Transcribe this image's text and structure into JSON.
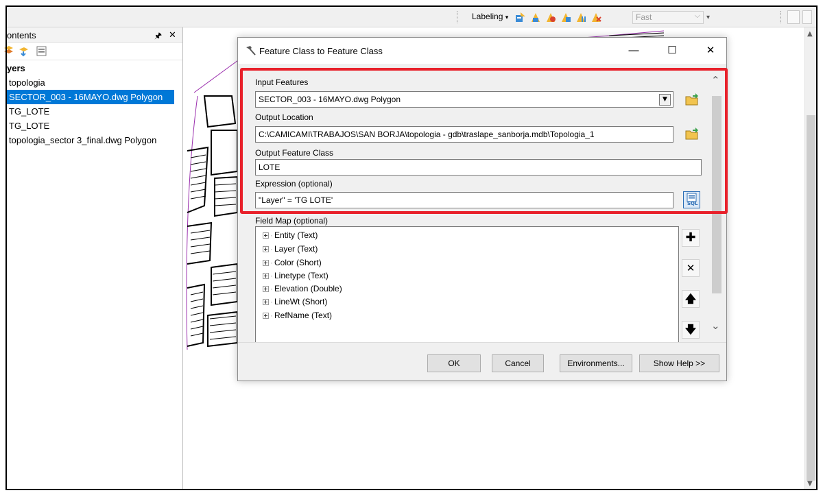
{
  "toolbar": {
    "labeling_label": "Labeling",
    "fast_value": "Fast"
  },
  "toc": {
    "header_label": "ontents",
    "group_label": "yers",
    "layers": [
      {
        "name": "topologia"
      },
      {
        "name": "SECTOR_003 - 16MAYO.dwg Polygon",
        "selected": true
      },
      {
        "name": "TG_LOTE"
      },
      {
        "name": "TG_LOTE"
      },
      {
        "name": "topologia_sector 3_final.dwg Polygon"
      }
    ]
  },
  "dialog": {
    "title": "Feature Class to Feature Class",
    "input_features_label": "Input Features",
    "input_features_value": "SECTOR_003 - 16MAYO.dwg Polygon",
    "output_location_label": "Output Location",
    "output_location_value": "C:\\CAMICAMI\\TRABAJOS\\SAN BORJA\\topologia - gdb\\traslape_sanborja.mdb\\Topologia_1",
    "output_feature_class_label": "Output Feature Class",
    "output_feature_class_value": "LOTE",
    "expression_label": "Expression (optional)",
    "expression_value": "\"Layer\" = 'TG LOTE'",
    "field_map_label": "Field Map (optional)",
    "field_map_items": [
      "Entity (Text)",
      "Layer (Text)",
      "Color (Short)",
      "Linetype (Text)",
      "Elevation (Double)",
      "LineWt (Short)",
      "RefName (Text)"
    ],
    "sql_label": "SQL",
    "buttons": {
      "ok": "OK",
      "cancel": "Cancel",
      "environments": "Environments...",
      "show_help": "Show Help >>"
    }
  },
  "colors": {
    "highlight": "#e8202a",
    "selection": "#0078d7",
    "map_boundary": "#9b2fae"
  }
}
